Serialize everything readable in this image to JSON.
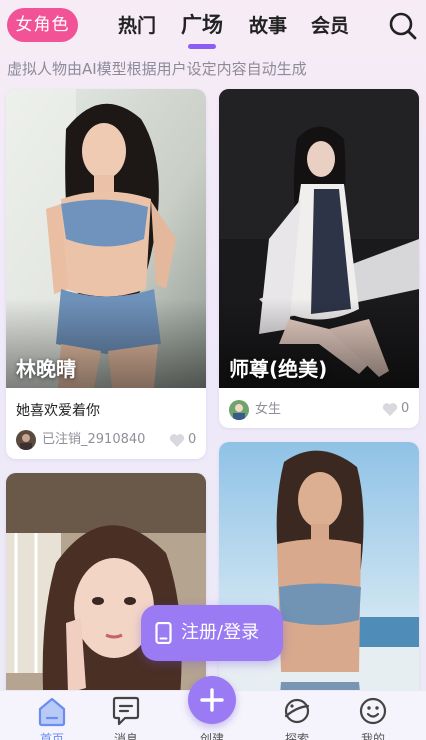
{
  "header": {
    "role_label": "女角色",
    "tabs": [
      {
        "label": "热门",
        "active": false
      },
      {
        "label": "广场",
        "active": true
      },
      {
        "label": "故事",
        "active": false
      },
      {
        "label": "会员",
        "active": false
      }
    ],
    "subtitle": "虚拟人物由AI模型根据用户设定内容自动生成"
  },
  "cards": [
    {
      "name": "林晚晴",
      "description": "她喜欢爱着你",
      "author": "已注销_2910840",
      "likes": "0"
    },
    {
      "name": "师尊(绝美)",
      "author": "女生",
      "likes": "0"
    },
    {
      "name": ""
    },
    {
      "name": ""
    }
  ],
  "login_button": {
    "label": "注册/登录",
    "icon": "phone-icon"
  },
  "bottom_nav": [
    {
      "label": "首页",
      "icon": "home-icon",
      "active": true
    },
    {
      "label": "消息",
      "icon": "message-icon",
      "active": false
    },
    {
      "label": "创建",
      "icon": "plus-icon",
      "active": false
    },
    {
      "label": "探索",
      "icon": "planet-icon",
      "active": false
    },
    {
      "label": "我的",
      "icon": "smiley-icon",
      "active": false
    }
  ],
  "colors": {
    "accent_pink": "#f25296",
    "accent_purple": "#9a7bf3",
    "tab_underline": "#8c5cf6",
    "active_nav": "#6b8cf0"
  }
}
